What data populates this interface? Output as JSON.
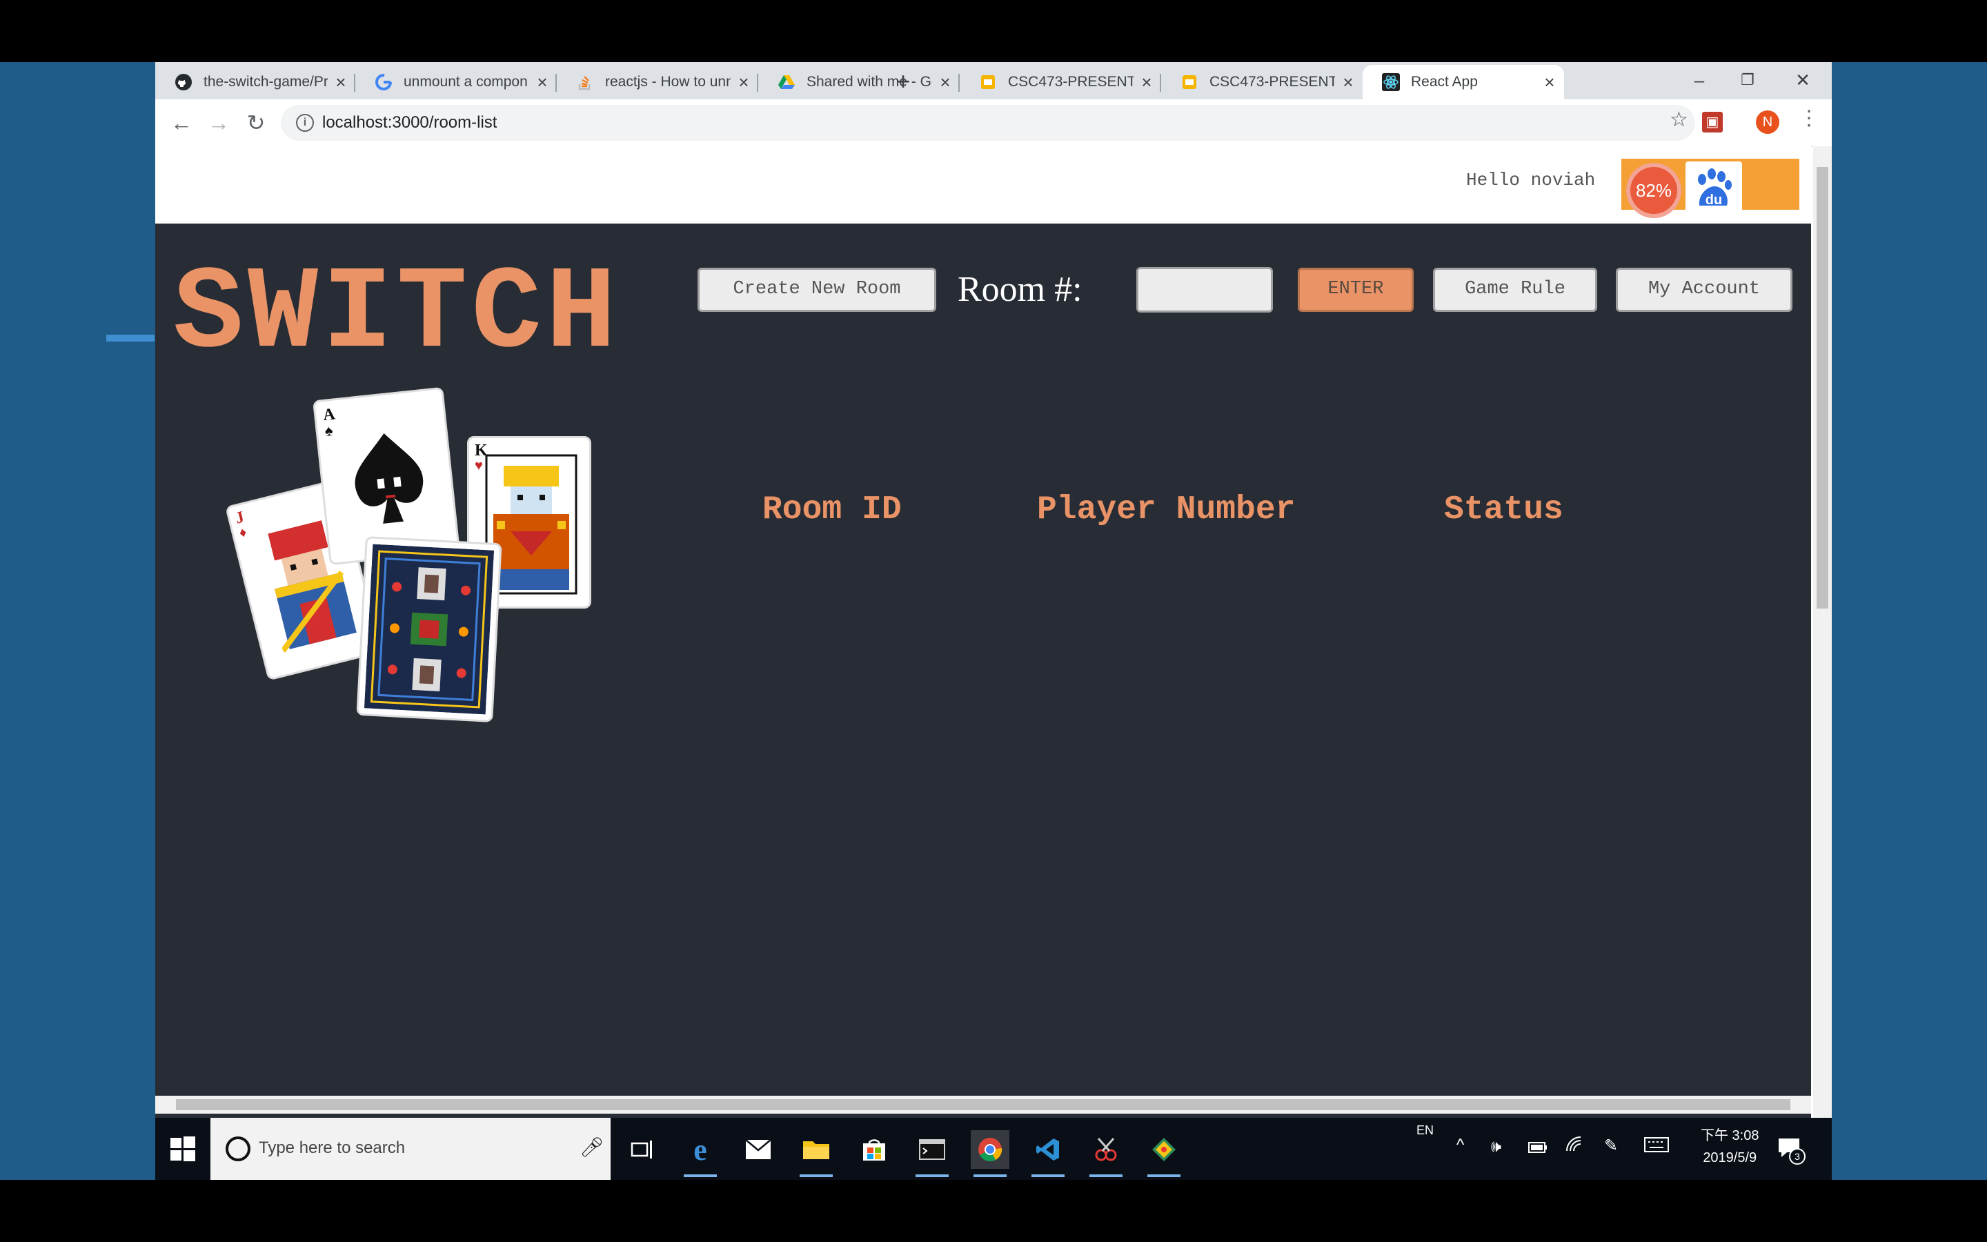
{
  "browser": {
    "tabs": [
      {
        "title": "the-switch-game/Pr",
        "icon": "github-icon"
      },
      {
        "title": "unmount a compon",
        "icon": "google-icon"
      },
      {
        "title": "reactjs - How to unn",
        "icon": "stackoverflow-icon"
      },
      {
        "title": "Shared with me - Go",
        "icon": "google-drive-icon"
      },
      {
        "title": "CSC473-PRESENT#6",
        "icon": "google-slides-icon"
      },
      {
        "title": "CSC473-PRESENT#7",
        "icon": "google-slides-icon"
      },
      {
        "title": "React App",
        "icon": "react-icon",
        "active": true
      }
    ],
    "url": "localhost:3000/room-list",
    "profile_initial": "N"
  },
  "header": {
    "greeting": "Hello noviah",
    "overlay_percent": "82%",
    "baidu_label": "du"
  },
  "app": {
    "logo": "SWITCH",
    "create_room_label": "Create New Room",
    "room_label": "Room #:",
    "room_input_value": "",
    "enter_label": "ENTER",
    "game_rule_label": "Game Rule",
    "my_account_label": "My Account"
  },
  "room_table": {
    "columns": [
      "Room ID",
      "Player Number",
      "Status"
    ],
    "rows": []
  },
  "cards": [
    {
      "rank": "J",
      "suit": "♦"
    },
    {
      "rank": "A",
      "suit": "♠"
    },
    {
      "rank": "K",
      "suit": "♥"
    }
  ],
  "taskbar": {
    "search_placeholder": "Type here to search",
    "language": "EN",
    "time": "下午 3:08",
    "date": "2019/5/9",
    "notification_count": "3"
  },
  "colors": {
    "accent": "#e99367",
    "page_bg": "#282c34",
    "stage_bg": "#1f5c89"
  }
}
